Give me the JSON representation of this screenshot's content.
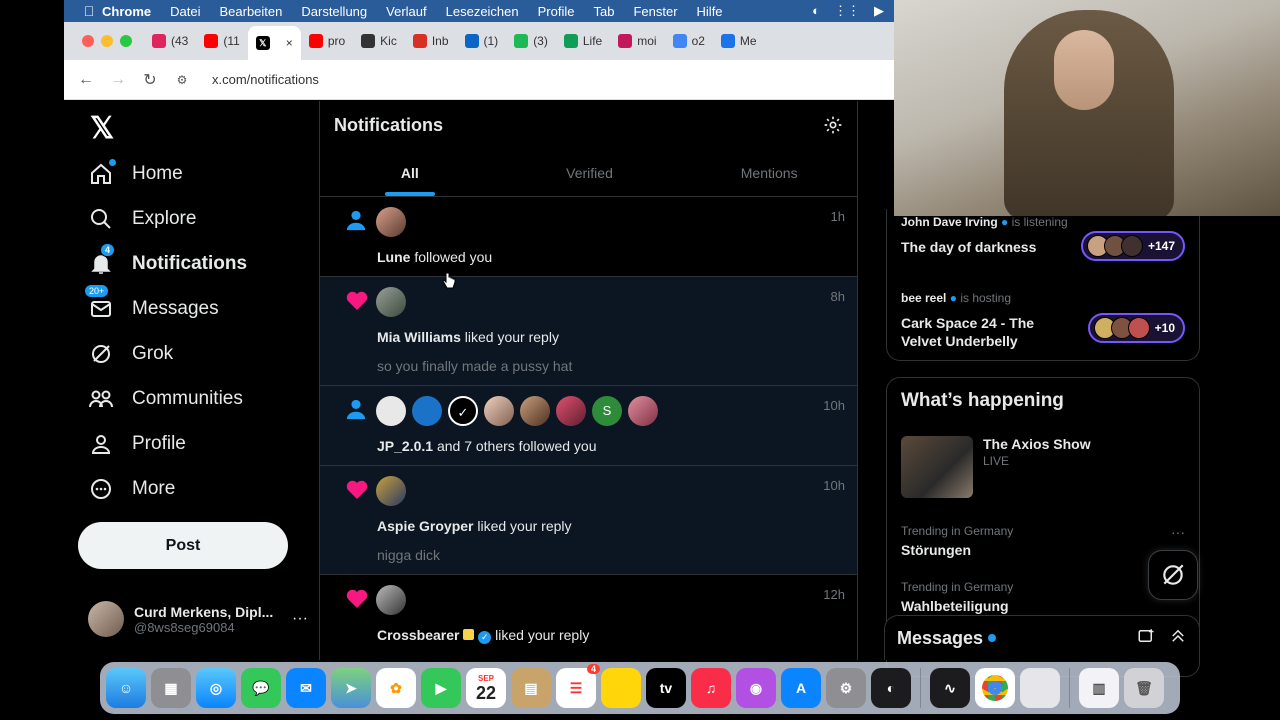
{
  "menubar": {
    "app": "Chrome",
    "items": [
      "Datei",
      "Bearbeiten",
      "Darstellung",
      "Verlauf",
      "Lesezeichen",
      "Profile",
      "Tab",
      "Fenster",
      "Hilfe"
    ]
  },
  "browser": {
    "tabs": [
      {
        "label": "(43",
        "color": "#e0245e",
        "icon": "notification-count-icon"
      },
      {
        "label": "(11",
        "color": "#ff0000",
        "icon": "youtube-icon"
      },
      {
        "label": "",
        "color": "#000000",
        "icon": "x-icon",
        "active": true
      },
      {
        "label": "pro",
        "color": "#ff0000",
        "icon": "youtube-icon"
      },
      {
        "label": "Kic",
        "color": "#333333",
        "icon": "grid-icon"
      },
      {
        "label": "Inb",
        "color": "#d93025",
        "icon": "gmail-icon"
      },
      {
        "label": "(1)",
        "color": "#0a66c2",
        "icon": "linkedin-icon"
      },
      {
        "label": "(3)",
        "color": "#1db954",
        "icon": "app-icon"
      },
      {
        "label": "Life",
        "color": "#0f9d58",
        "icon": "plus-icon"
      },
      {
        "label": "moi",
        "color": "#c2185b",
        "icon": "app-icon"
      },
      {
        "label": "o2",
        "color": "#4285f4",
        "icon": "google-icon"
      },
      {
        "label": "Me",
        "color": "#1a73e8",
        "icon": "search-icon"
      }
    ],
    "close_glyph": "×",
    "url": "x.com/notifications"
  },
  "nav": {
    "items": [
      {
        "label": "Home",
        "icon": "home-icon",
        "bold": false
      },
      {
        "label": "Explore",
        "icon": "search-icon",
        "bold": false
      },
      {
        "label": "Notifications",
        "icon": "bell-icon",
        "bold": true,
        "badge": "4"
      },
      {
        "label": "Messages",
        "icon": "mail-icon",
        "bold": false,
        "badge": "20+"
      },
      {
        "label": "Grok",
        "icon": "grok-icon",
        "bold": false
      },
      {
        "label": "Communities",
        "icon": "communities-icon",
        "bold": false
      },
      {
        "label": "Profile",
        "icon": "person-icon",
        "bold": false
      },
      {
        "label": "More",
        "icon": "more-circle-icon",
        "bold": false
      }
    ],
    "post_label": "Post",
    "account": {
      "name": "Curd Merkens, Dipl...",
      "handle": "@8ws8seg69084"
    }
  },
  "main": {
    "title": "Notifications",
    "tabs": [
      "All",
      "Verified",
      "Mentions"
    ],
    "notifications": [
      {
        "kind": "follow",
        "time": "1h",
        "name": "Lune",
        "text": " followed you",
        "sub": ""
      },
      {
        "kind": "like",
        "time": "8h",
        "name": "Mia Williams",
        "text": " liked your reply",
        "sub": "so you finally made a pussy hat"
      },
      {
        "kind": "follow",
        "time": "10h",
        "name": "JP_2.0.1",
        "text": " and 7 others followed you",
        "sub": ""
      },
      {
        "kind": "like",
        "time": "10h",
        "name": "Aspie Groyper",
        "text": " liked your reply",
        "sub": "nigga dick"
      },
      {
        "kind": "like",
        "time": "12h",
        "name": "Crossbearer",
        "text": " liked your reply",
        "sub": ""
      }
    ]
  },
  "spaces": [
    {
      "host": "John Dave Irving",
      "role": "is listening",
      "title": "The day of darkness",
      "count": "+147"
    },
    {
      "host": "bee reel",
      "role": "is hosting",
      "title": "Cark Space 24 - The Velvet Underbelly",
      "count": "+10"
    }
  ],
  "happening": {
    "title": "What’s happening",
    "show": {
      "name": "The Axios Show",
      "status": "LIVE"
    },
    "trends": [
      {
        "context": "Trending in Germany",
        "name": "Störungen"
      },
      {
        "context": "Trending in Germany",
        "name": "Wahlbeteiligung"
      }
    ]
  },
  "messages_drawer": {
    "title": "Messages"
  },
  "dock": {
    "calendar": {
      "month": "SEP",
      "day": "22"
    },
    "reminders_badge": "4",
    "tv_label": "tv"
  },
  "colors": {
    "accent": "#1d9bf0",
    "like": "#f91880",
    "spaces": "#7856ff"
  }
}
